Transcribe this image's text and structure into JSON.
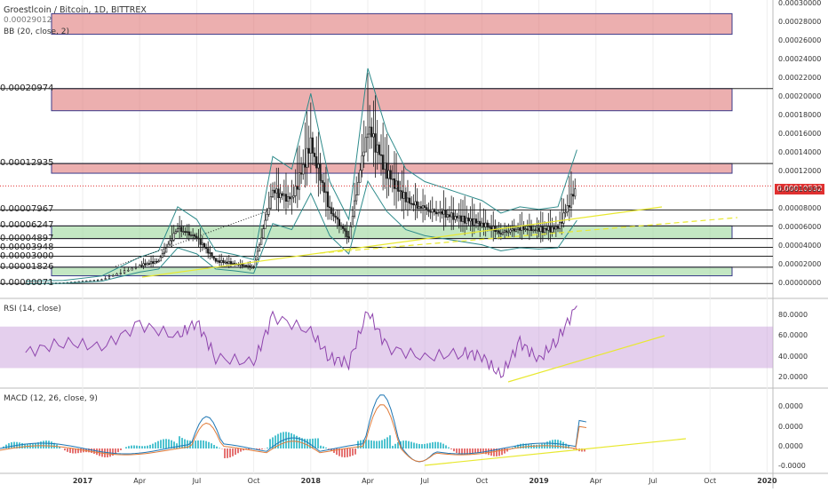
{
  "header": {
    "symbol_line": "Groestlcoin / Bitcoin, 1D, BITTREX",
    "bb_label": "BB (20, close, 2)",
    "rsi_label": "RSI (14, close)",
    "macd_label": "MACD (12, 26, close, 9)",
    "clipped_label": "0.00029012"
  },
  "colors": {
    "price_candle": "#1a1a1a",
    "bb_band": "#2e8b8b",
    "zone_red": "#e07a7a",
    "zone_green": "#9bd79b",
    "rsi_line": "#8e44ad",
    "rsi_band": "#c9a0dc",
    "macd_line": "#1f77b4",
    "signal_line": "#e07b39",
    "trendline_yellow": "#e8e830",
    "last_price_bg": "#e03030"
  },
  "last_price": "0.00010532",
  "price_levels": [
    {
      "label": "0.00020974",
      "value": 0.00020974
    },
    {
      "label": "0.00012935",
      "value": 0.00012935
    },
    {
      "label": "0.00007967",
      "value": 7.967e-05
    },
    {
      "label": "0.00006247",
      "value": 6.247e-05
    },
    {
      "label": "0.00004897",
      "value": 4.897e-05
    },
    {
      "label": "0.00003948",
      "value": 3.948e-05
    },
    {
      "label": "0.00003000",
      "value": 3e-05
    },
    {
      "label": "0.00001826",
      "value": 1.826e-05
    },
    {
      "label": "0.00000071",
      "value": 7.1e-07
    }
  ],
  "price_axis_ticks": [
    "0.00030000",
    "0.00028000",
    "0.00026000",
    "0.00024000",
    "0.00022000",
    "0.00020000",
    "0.00018000",
    "0.00016000",
    "0.00014000",
    "0.00012000",
    "0.00010000",
    "0.00008000",
    "0.00006000",
    "0.00004000",
    "0.00002000",
    "0.00000000"
  ],
  "rsi_axis_ticks": [
    "80.0000",
    "60.0000",
    "40.0000",
    "20.0000"
  ],
  "macd_axis_ticks": [
    "0.0000",
    "0.0000",
    "0.0000",
    "-0.0000"
  ],
  "time_ticks": [
    "2017",
    "Apr",
    "Jul",
    "Oct",
    "2018",
    "Apr",
    "Jul",
    "Oct",
    "2019",
    "Apr",
    "Jul",
    "Oct",
    "2020"
  ],
  "chart_data": {
    "type": "candlestick",
    "title": "Groestlcoin / Bitcoin, 1D, BITTREX",
    "x_range": [
      "2016-10",
      "2020-01"
    ],
    "y_range": [
      0.0,
      0.0003
    ],
    "zones": [
      {
        "type": "resistance",
        "range": [
          0.000268,
          0.00029012
        ]
      },
      {
        "type": "resistance",
        "range": [
          0.000186,
          0.00020974
        ]
      },
      {
        "type": "resistance",
        "range": [
          0.000119,
          0.00012935
        ]
      },
      {
        "type": "support",
        "range": [
          4.897e-05,
          6.247e-05
        ]
      },
      {
        "type": "support",
        "range": [
          9e-06,
          1.826e-05
        ]
      }
    ],
    "price_series": {
      "name": "close",
      "x": [
        "2016-10",
        "2016-12",
        "2017-02",
        "2017-04",
        "2017-05",
        "2017-06",
        "2017-07",
        "2017-08",
        "2017-09",
        "2017-10",
        "2017-11",
        "2017-12",
        "2018-01",
        "2018-02",
        "2018-03",
        "2018-04",
        "2018-05",
        "2018-06",
        "2018-07",
        "2018-08",
        "2018-09",
        "2018-10",
        "2018-11",
        "2018-12",
        "2019-01",
        "2019-02",
        "2019-03"
      ],
      "y": [
        1e-06,
        1.5e-06,
        5e-06,
        2e-05,
        2.5e-05,
        6e-05,
        5e-05,
        2.5e-05,
        2.2e-05,
        1.8e-05,
        0.0001,
        9e-05,
        0.00015,
        8e-05,
        5e-05,
        0.00017,
        0.00012,
        9e-05,
        8e-05,
        7.5e-05,
        7e-05,
        6.5e-05,
        5.5e-05,
        6e-05,
        5.8e-05,
        6e-05,
        0.0001053
      ]
    },
    "rsi": {
      "name": "RSI (14, close)",
      "y_range": [
        15,
        92
      ],
      "band": [
        30,
        70
      ],
      "x": [
        "2016-10",
        "2016-12",
        "2017-02",
        "2017-04",
        "2017-06",
        "2017-07",
        "2017-08",
        "2017-10",
        "2017-11",
        "2018-01",
        "2018-02",
        "2018-03",
        "2018-04",
        "2018-05",
        "2018-07",
        "2018-09",
        "2018-10",
        "2018-11",
        "2018-12",
        "2019-01",
        "2019-02",
        "2019-03"
      ],
      "y": [
        45,
        55,
        50,
        72,
        60,
        75,
        40,
        35,
        80,
        65,
        40,
        35,
        85,
        50,
        40,
        45,
        42,
        22,
        55,
        38,
        58,
        90
      ]
    },
    "macd": {
      "name": "MACD (12, 26, close, 9)",
      "y_range": [
        -1.2e-05,
        2.5e-05
      ]
    },
    "trendlines": [
      {
        "pane": "price",
        "style": "solid-yellow"
      },
      {
        "pane": "price",
        "style": "dashed-yellow"
      },
      {
        "pane": "rsi",
        "style": "solid-yellow"
      },
      {
        "pane": "macd",
        "style": "solid-yellow"
      }
    ]
  }
}
